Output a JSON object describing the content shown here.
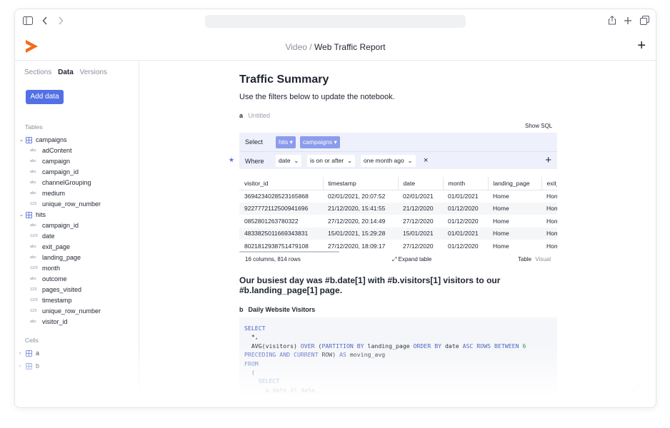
{
  "header": {
    "breadcrumb_parent": "Video",
    "breadcrumb_sep": " / ",
    "breadcrumb_current": "Web Traffic Report",
    "new_icon": "plus-icon"
  },
  "sidebar": {
    "tabs": [
      "Sections",
      "Data",
      "Versions"
    ],
    "active_tab": "Data",
    "add_button": "Add data",
    "tables_label": "Tables",
    "cells_label": "Cells",
    "tables": [
      {
        "name": "campaigns",
        "columns": [
          {
            "type": "abc",
            "name": "adContent"
          },
          {
            "type": "abc",
            "name": "campaign"
          },
          {
            "type": "abc",
            "name": "campaign_id"
          },
          {
            "type": "abc",
            "name": "channelGrouping"
          },
          {
            "type": "abc",
            "name": "medium"
          },
          {
            "type": "123",
            "name": "unique_row_number"
          }
        ]
      },
      {
        "name": "hits",
        "columns": [
          {
            "type": "abc",
            "name": "campaign_id"
          },
          {
            "type": "12/3",
            "name": "date"
          },
          {
            "type": "abc",
            "name": "exit_page"
          },
          {
            "type": "abc",
            "name": "landing_page"
          },
          {
            "type": "12/3",
            "name": "month"
          },
          {
            "type": "abc",
            "name": "outcome"
          },
          {
            "type": "123",
            "name": "pages_visited"
          },
          {
            "type": "12/3",
            "name": "timestamp"
          },
          {
            "type": "123",
            "name": "unique_row_number"
          },
          {
            "type": "abc",
            "name": "visitor_id"
          }
        ]
      }
    ],
    "cells": [
      "a",
      "b"
    ]
  },
  "main": {
    "title": "Traffic Summary",
    "subtitle": "Use the filters below to update the notebook.",
    "cell_a": {
      "badge": "a",
      "name": "Untitled",
      "show_sql": "Show SQL",
      "select_label": "Select",
      "select_table_1": "hits",
      "select_table_2": "campaigns",
      "where_label": "Where",
      "where_field": "date",
      "where_op": "is on or after",
      "where_value": "one month ago",
      "remove": "×",
      "add": "+",
      "columns": [
        "visitor_id",
        "timestamp",
        "date",
        "month",
        "landing_page",
        "exit_"
      ],
      "rows": [
        [
          "3694234028523165868",
          "02/01/2021, 20:07:52",
          "02/01/2021",
          "01/01/2021",
          "Home",
          "Hon"
        ],
        [
          "9227772112500941696",
          "21/12/2020, 15:41:55",
          "21/12/2020",
          "01/12/2020",
          "Home",
          "Hom"
        ],
        [
          "0852801263780322",
          "27/12/2020, 20:14:49",
          "27/12/2020",
          "01/12/2020",
          "Home",
          "Hom"
        ],
        [
          "4833825011669343831",
          "15/01/2021, 15:29:28",
          "15/01/2021",
          "01/01/2021",
          "Home",
          "Hom"
        ],
        [
          "8021812938751479108",
          "27/12/2020, 18:09:17",
          "27/12/2020",
          "01/12/2020",
          "Home",
          "Hom"
        ]
      ],
      "summary": "16 columns, 814 rows",
      "expand": "Expand table",
      "view_table": "Table",
      "view_visual": "Visual"
    },
    "heading": "Our busiest day was #b.date[1] with #b.visitors[1] visitors to our #b.landing_page[1] page.",
    "cell_b": {
      "badge": "b",
      "name": "Daily Website Visitors"
    }
  },
  "colors": {
    "accent": "#5470e5",
    "pill": "#8c9cec",
    "query_bg": "#eef0fb",
    "logo": "#f26a1b"
  }
}
